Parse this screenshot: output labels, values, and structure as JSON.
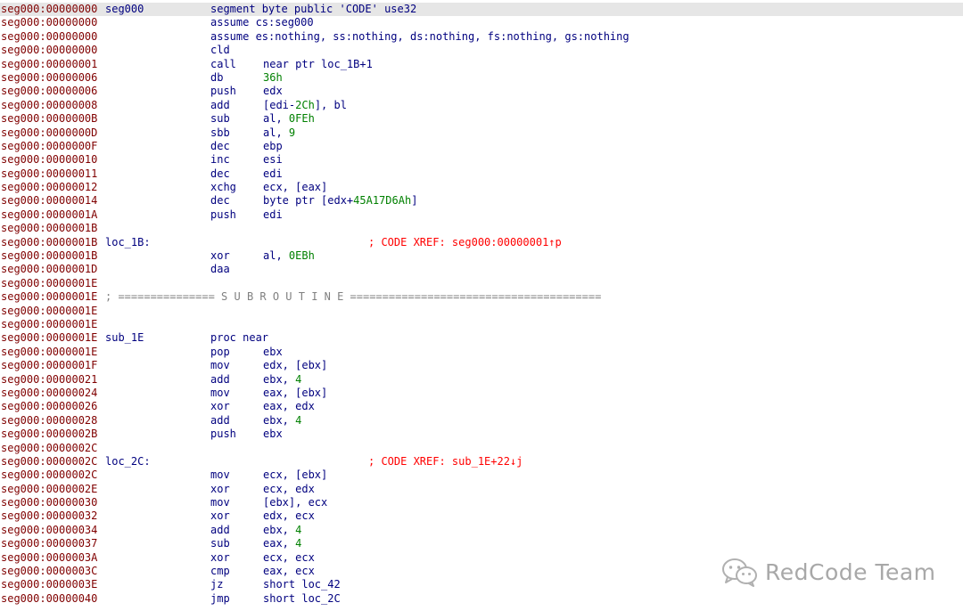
{
  "listing": [
    {
      "addr": "seg000:00000000",
      "label": "seg000",
      "mnem": "segment byte public 'CODE' use32",
      "highlighted": true
    },
    {
      "addr": "seg000:00000000",
      "mnem": "assume cs:seg000"
    },
    {
      "addr": "seg000:00000000",
      "mnem": "assume es:nothing, ss:nothing, ds:nothing, fs:nothing, gs:nothing"
    },
    {
      "addr": "seg000:00000000",
      "mnem": "cld"
    },
    {
      "addr": "seg000:00000001",
      "mnem": "call",
      "ops": [
        {
          "t": "near ptr loc_1B+1"
        }
      ]
    },
    {
      "addr": "seg000:00000006",
      "mnem": "db",
      "ops": [
        {
          "t": "36h",
          "num": true
        }
      ]
    },
    {
      "addr": "seg000:00000006",
      "mnem": "push",
      "ops": [
        {
          "t": "edx"
        }
      ]
    },
    {
      "addr": "seg000:00000008",
      "mnem": "add",
      "ops": [
        {
          "t": "[edi-"
        },
        {
          "t": "2Ch",
          "num": true
        },
        {
          "t": "], bl"
        }
      ]
    },
    {
      "addr": "seg000:0000000B",
      "mnem": "sub",
      "ops": [
        {
          "t": "al, "
        },
        {
          "t": "0FEh",
          "num": true
        }
      ]
    },
    {
      "addr": "seg000:0000000D",
      "mnem": "sbb",
      "ops": [
        {
          "t": "al, "
        },
        {
          "t": "9",
          "num": true
        }
      ]
    },
    {
      "addr": "seg000:0000000F",
      "mnem": "dec",
      "ops": [
        {
          "t": "ebp"
        }
      ]
    },
    {
      "addr": "seg000:00000010",
      "mnem": "inc",
      "ops": [
        {
          "t": "esi"
        }
      ]
    },
    {
      "addr": "seg000:00000011",
      "mnem": "dec",
      "ops": [
        {
          "t": "edi"
        }
      ]
    },
    {
      "addr": "seg000:00000012",
      "mnem": "xchg",
      "ops": [
        {
          "t": "ecx, [eax]"
        }
      ]
    },
    {
      "addr": "seg000:00000014",
      "mnem": "dec",
      "ops": [
        {
          "t": "byte ptr [edx+"
        },
        {
          "t": "45A17D6Ah",
          "num": true
        },
        {
          "t": "]"
        }
      ]
    },
    {
      "addr": "seg000:0000001A",
      "mnem": "push",
      "ops": [
        {
          "t": "edi"
        }
      ]
    },
    {
      "addr": "seg000:0000001B"
    },
    {
      "addr": "seg000:0000001B",
      "label": "loc_1B:",
      "xref": "; CODE XREF: seg000:00000001↑p"
    },
    {
      "addr": "seg000:0000001B",
      "mnem": "xor",
      "ops": [
        {
          "t": "al, "
        },
        {
          "t": "0EBh",
          "num": true
        }
      ]
    },
    {
      "addr": "seg000:0000001D",
      "mnem": "daa"
    },
    {
      "addr": "seg000:0000001E"
    },
    {
      "addr": "seg000:0000001E",
      "sep": "; =============== S U B R O U T I N E ======================================="
    },
    {
      "addr": "seg000:0000001E"
    },
    {
      "addr": "seg000:0000001E"
    },
    {
      "addr": "seg000:0000001E",
      "label": "sub_1E",
      "mnem": "proc near"
    },
    {
      "addr": "seg000:0000001E",
      "mnem": "pop",
      "ops": [
        {
          "t": "ebx"
        }
      ]
    },
    {
      "addr": "seg000:0000001F",
      "mnem": "mov",
      "ops": [
        {
          "t": "edx, [ebx]"
        }
      ]
    },
    {
      "addr": "seg000:00000021",
      "mnem": "add",
      "ops": [
        {
          "t": "ebx, "
        },
        {
          "t": "4",
          "num": true
        }
      ]
    },
    {
      "addr": "seg000:00000024",
      "mnem": "mov",
      "ops": [
        {
          "t": "eax, [ebx]"
        }
      ]
    },
    {
      "addr": "seg000:00000026",
      "mnem": "xor",
      "ops": [
        {
          "t": "eax, edx"
        }
      ]
    },
    {
      "addr": "seg000:00000028",
      "mnem": "add",
      "ops": [
        {
          "t": "ebx, "
        },
        {
          "t": "4",
          "num": true
        }
      ]
    },
    {
      "addr": "seg000:0000002B",
      "mnem": "push",
      "ops": [
        {
          "t": "ebx"
        }
      ]
    },
    {
      "addr": "seg000:0000002C"
    },
    {
      "addr": "seg000:0000002C",
      "label": "loc_2C:",
      "xref": "; CODE XREF: sub_1E+22↓j"
    },
    {
      "addr": "seg000:0000002C",
      "mnem": "mov",
      "ops": [
        {
          "t": "ecx, [ebx]"
        }
      ]
    },
    {
      "addr": "seg000:0000002E",
      "mnem": "xor",
      "ops": [
        {
          "t": "ecx, edx"
        }
      ]
    },
    {
      "addr": "seg000:00000030",
      "mnem": "mov",
      "ops": [
        {
          "t": "[ebx], ecx"
        }
      ]
    },
    {
      "addr": "seg000:00000032",
      "mnem": "xor",
      "ops": [
        {
          "t": "edx, ecx"
        }
      ]
    },
    {
      "addr": "seg000:00000034",
      "mnem": "add",
      "ops": [
        {
          "t": "ebx, "
        },
        {
          "t": "4",
          "num": true
        }
      ]
    },
    {
      "addr": "seg000:00000037",
      "mnem": "sub",
      "ops": [
        {
          "t": "eax, "
        },
        {
          "t": "4",
          "num": true
        }
      ]
    },
    {
      "addr": "seg000:0000003A",
      "mnem": "xor",
      "ops": [
        {
          "t": "ecx, ecx"
        }
      ]
    },
    {
      "addr": "seg000:0000003C",
      "mnem": "cmp",
      "ops": [
        {
          "t": "eax, ecx"
        }
      ]
    },
    {
      "addr": "seg000:0000003E",
      "mnem": "jz",
      "ops": [
        {
          "t": "short loc_42"
        }
      ]
    },
    {
      "addr": "seg000:00000040",
      "mnem": "jmp",
      "ops": [
        {
          "t": "short loc_2C"
        }
      ]
    }
  ],
  "colors": {
    "address": "#800000",
    "instruction": "#00007f",
    "number": "#008000",
    "xref": "#ff0000",
    "separator": "#808080",
    "highlight": "#e6e6e6"
  },
  "watermark": {
    "icon": "wechat-icon",
    "text": "RedCode Team"
  }
}
